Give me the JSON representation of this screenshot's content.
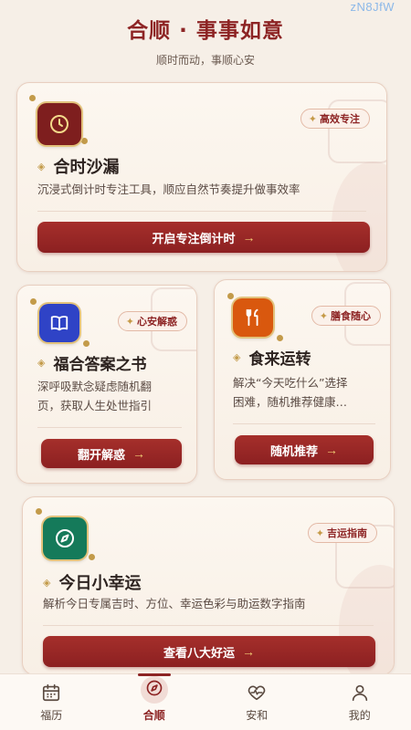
{
  "watermark": "zN8JfW",
  "header": {
    "title": "合顺 · 事事如意",
    "subtitle": "顺时而动，事顺心安"
  },
  "cards": {
    "hourglass": {
      "badge": "高效专注",
      "title": "合时沙漏",
      "desc": "沉浸式倒计时专注工具，顺应自然节奏提升做事效率",
      "button": "开启专注倒计时",
      "icon": "clock-icon",
      "icon_color": "#7e1e1e"
    },
    "answers": {
      "badge": "心安解惑",
      "title": "福合答案之书",
      "desc_line1": "深呼吸默念疑虑随机翻",
      "desc_line2": "页，获取人生处世指引",
      "button": "翻开解惑",
      "icon": "book-icon",
      "icon_color": "#2f43c6"
    },
    "food": {
      "badge": "膳食随心",
      "title": "食来运转",
      "desc_line1": "解决“今天吃什么”选择",
      "desc_line2": "困难，随机推荐健康…",
      "button": "随机推荐",
      "icon": "fork-knife-icon",
      "icon_color": "#d9580e"
    },
    "luck": {
      "badge": "吉运指南",
      "title": "今日小幸运",
      "desc": "解析今日专属吉时、方位、幸运色彩与助运数字指南",
      "button": "查看八大好运",
      "icon": "compass-icon",
      "icon_color": "#157a5a"
    }
  },
  "tabs": [
    {
      "label": "福历",
      "icon": "calendar-icon"
    },
    {
      "label": "合顺",
      "icon": "compass-icon",
      "active": true
    },
    {
      "label": "安和",
      "icon": "heartbeat-icon"
    },
    {
      "label": "我的",
      "icon": "user-icon"
    }
  ],
  "colors": {
    "brand_red": "#8d2424",
    "gold": "#c39b4a",
    "background": "#f6efe7"
  }
}
